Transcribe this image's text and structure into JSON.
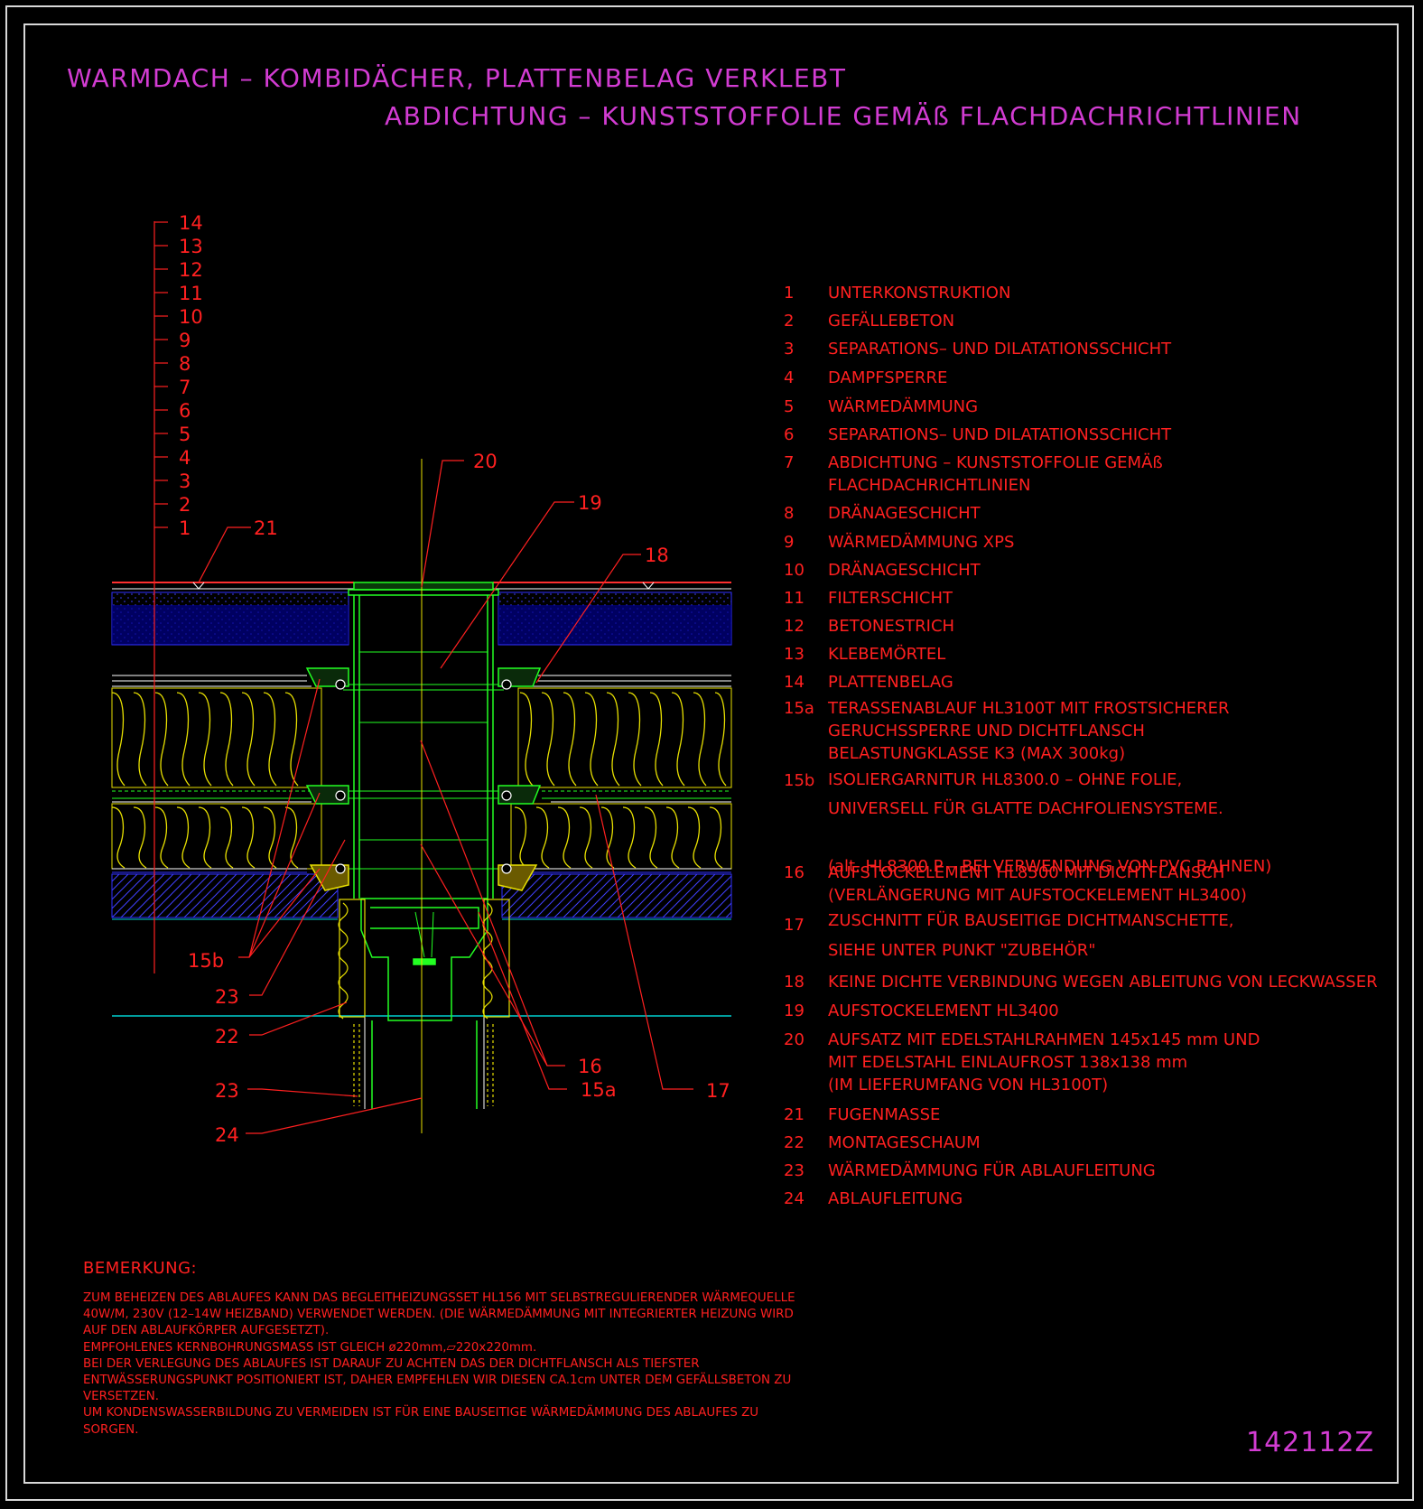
{
  "title_line_1": "WARMDACH – KOMBIDÄCHER, PLATTENBELAG VERKLEBT",
  "title_line_2": "ABDICHTUNG – KUNSTSTOFFOLIE GEMÄß FLACHDACHRICHTLINIEN",
  "layer_scale": [
    "14",
    "13",
    "12",
    "11",
    "10",
    "9",
    "8",
    "7",
    "6",
    "5",
    "4",
    "3",
    "2",
    "1"
  ],
  "callouts": {
    "c20": "20",
    "c19": "19",
    "c18": "18",
    "c21": "21",
    "c15b": "15b",
    "c23a": "23",
    "c22": "22",
    "c23b": "23",
    "c24": "24",
    "c16": "16",
    "c15a": "15a",
    "c17": "17"
  },
  "legend": [
    {
      "num": "1",
      "text": "UNTERKONSTRUKTION"
    },
    {
      "num": "2",
      "text": "GEFÄLLEBETON"
    },
    {
      "num": "3",
      "text": "SEPARATIONS– UND DILATATIONSSCHICHT"
    },
    {
      "num": "4",
      "text": "DAMPFSPERRE"
    },
    {
      "num": "5",
      "text": "WÄRMEDÄMMUNG"
    },
    {
      "num": "6",
      "text": "SEPARATIONS– UND DILATATIONSSCHICHT"
    },
    {
      "num": "7",
      "text": "ABDICHTUNG – KUNSTSTOFFOLIE GEMÄß\nFLACHDACHRICHTLINIEN"
    },
    {
      "num": "8",
      "text": "DRÄNAGESCHICHT"
    },
    {
      "num": "9",
      "text": "WÄRMEDÄMMUNG XPS"
    },
    {
      "num": "10",
      "text": "DRÄNAGESCHICHT"
    },
    {
      "num": "11",
      "text": "FILTERSCHICHT"
    },
    {
      "num": "12",
      "text": "BETONESTRICH"
    },
    {
      "num": "13",
      "text": "KLEBEMÖRTEL"
    },
    {
      "num": "14",
      "text": "PLATTENBELAG"
    },
    {
      "num": "15a",
      "text": "TERASSENABLAUF HL3100T MIT FROSTSICHERER\nGERUCHSSPERRE UND DICHTFLANSCH\nBELASTUNGKLASSE K3 (MAX 300kg)"
    },
    {
      "num": "15b",
      "text": "ISOLIERGARNITUR HL8300.0 – OHNE FOLIE,\nUNIVERSELL FÜR GLATTE DACHFOLIENSYSTEME.\n\n(alt. HL8300.P – BEI VERWENDUNG VON PVC BAHNEN)"
    },
    {
      "num": "16",
      "text": "AUFSTOCKELEMENT HL8500 MIT DICHTFLANSCH\n(VERLÄNGERUNG MIT AUFSTOCKELEMENT HL3400)"
    },
    {
      "num": "17",
      "text": "ZUSCHNITT FÜR BAUSEITIGE DICHTMANSCHETTE,\n\nSIEHE UNTER PUNKT \"ZUBEHÖR\""
    },
    {
      "num": "18",
      "text": "KEINE DICHTE VERBINDUNG WEGEN ABLEITUNG VON LECKWASSER"
    },
    {
      "num": "19",
      "text": "AUFSTOCKELEMENT HL3400"
    },
    {
      "num": "20",
      "text": "AUFSATZ MIT EDELSTAHLRAHMEN 145x145 mm UND\nMIT EDELSTAHL EINLAUFROST 138x138 mm\n(IM LIEFERUMFANG VON HL3100T)"
    },
    {
      "num": "21",
      "text": "FUGENMASSE"
    },
    {
      "num": "22",
      "text": "MONTAGESCHAUM"
    },
    {
      "num": "23",
      "text": "WÄRMEDÄMMUNG FÜR ABLAUFLEITUNG"
    },
    {
      "num": "24",
      "text": "ABLAUFLEITUNG"
    }
  ],
  "remark_heading": "BEMERKUNG:",
  "remark_lines": [
    "ZUM BEHEIZEN DES ABLAUFES KANN DAS BEGLEITHEIZUNGSSET HL156 MIT SELBSTREGULIERENDER WÄRMEQUELLE",
    "40W/M, 230V (12–14W HEIZBAND) VERWENDET WERDEN. (DIE WÄRMEDÄMMUNG MIT INTEGRIERTER HEIZUNG WIRD",
    "AUF DEN ABLAUFKÖRPER AUFGESETZT).",
    "EMPFOHLENES KERNBOHRUNGSMASS IST GLEICH ø220mm,▱220x220mm.",
    "BEI DER VERLEGUNG DES ABLAUFES IST DARAUF ZU ACHTEN DAS DER DICHTFLANSCH ALS TIEFSTER",
    "ENTWÄSSERUNGSPUNKT POSITIONIERT IST, DAHER EMPFEHLEN WIR DIESEN CA.1cm UNTER DEM GEFÄLLSBETON ZU",
    "VERSETZEN.",
    "UM KONDENSWASSERBILDUNG ZU VERMEIDEN IST FÜR EINE BAUSEITIGE WÄRMEDÄMMUNG DES ABLAUFES ZU",
    "SORGEN."
  ],
  "drawing_code": "142112Z",
  "colors": {
    "title": "#d23cd2",
    "annotation": "#ff2020",
    "drain": "#22ff22",
    "insulation": "#e8e000",
    "concrete": "#3030ff",
    "membrane": "#ffffff",
    "base_line": "#00d0d0"
  }
}
